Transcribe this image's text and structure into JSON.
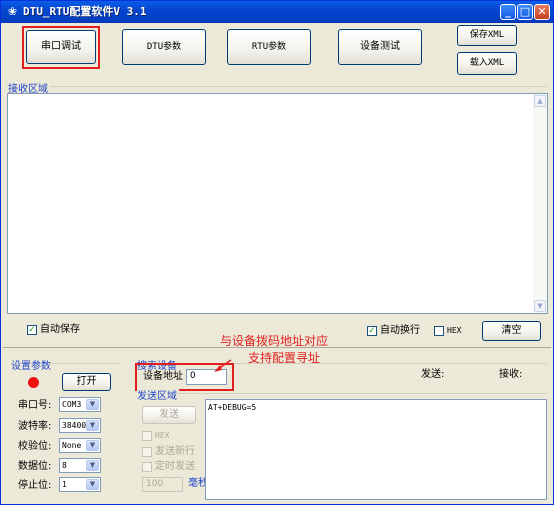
{
  "window": {
    "title": "DTU_RTU配置软件V 3.1"
  },
  "title_buttons": {
    "minimize": "_",
    "maximize": "□",
    "close": "✕"
  },
  "top_buttons": {
    "serial_debug": "串口调试",
    "dtu_params": "DTU参数",
    "rtu_params": "RTU参数",
    "device_test": "设备测试",
    "save_xml": "保存XML",
    "load_xml": "载入XML"
  },
  "receive": {
    "label": "接收区域"
  },
  "bottom_bar": {
    "auto_save": {
      "label": "自动保存",
      "checked": true
    },
    "auto_wrap": {
      "label": "自动换行",
      "checked": true
    },
    "hex": {
      "label": "HEX",
      "checked": false
    },
    "clear": "清空"
  },
  "settings": {
    "label": "设置参数",
    "status_color": "#ee1111",
    "open_button": "打开",
    "port_label": "串口号:",
    "port_value": "COM3",
    "baud_label": "波特率:",
    "baud_value": "38400",
    "parity_label": "校验位:",
    "parity_value": "None",
    "databits_label": "数据位:",
    "databits_value": "8",
    "stopbits_label": "停止位:",
    "stopbits_value": "1"
  },
  "search": {
    "label": "搜索设备",
    "device_addr_label": "设备地址",
    "device_addr_value": "0",
    "send_status_label": "发送:",
    "recv_status_label": "接收:"
  },
  "send": {
    "label": "发送区域",
    "send_button": "发送",
    "hex_label": "HEX",
    "newline_label": "发送新行",
    "timed_label": "定时发送",
    "interval_value": "100",
    "interval_unit": "毫秒",
    "content": "AT+DEBUG=5"
  },
  "annotation": {
    "line1": "与设备拨码地址对应",
    "line2": "支持配置寻址",
    "color": "#e02020"
  }
}
